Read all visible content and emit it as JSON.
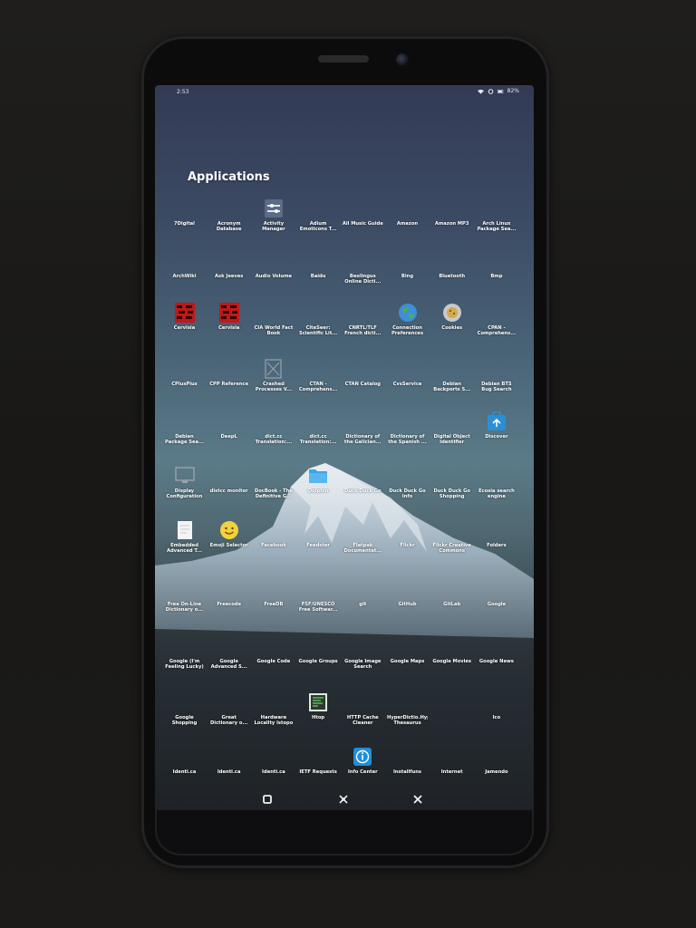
{
  "status": {
    "time": "2:53",
    "battery": "82%"
  },
  "title": "Applications",
  "apps": [
    {
      "label": "7Digital",
      "icon": "none"
    },
    {
      "label": "Acronym Database",
      "icon": "none"
    },
    {
      "label": "Activity Manager",
      "icon": "activity-manager"
    },
    {
      "label": "Adium Emoticons T...",
      "icon": "none"
    },
    {
      "label": "All Music Guide",
      "icon": "none"
    },
    {
      "label": "Amazon",
      "icon": "none"
    },
    {
      "label": "Amazon MP3",
      "icon": "none"
    },
    {
      "label": "Arch Linux Package Sea...",
      "icon": "none"
    },
    {
      "label": "ArchWiki",
      "icon": "none"
    },
    {
      "label": "Ask Jeeves",
      "icon": "none"
    },
    {
      "label": "Audio Volume",
      "icon": "none"
    },
    {
      "label": "Baidu",
      "icon": "none"
    },
    {
      "label": "Beolingus Online Dicti...",
      "icon": "none"
    },
    {
      "label": "Bing",
      "icon": "none"
    },
    {
      "label": "Bluetooth",
      "icon": "none"
    },
    {
      "label": "Bmp",
      "icon": "none"
    },
    {
      "label": "Cervisia",
      "icon": "cervisia"
    },
    {
      "label": "Cervisia",
      "icon": "cervisia"
    },
    {
      "label": "CIA World Fact Book",
      "icon": "none"
    },
    {
      "label": "CiteSeer: Scientific Lit...",
      "icon": "none"
    },
    {
      "label": "CNRTL/TLF French dicti...",
      "icon": "none"
    },
    {
      "label": "Connection Preferences",
      "icon": "globe"
    },
    {
      "label": "Cookies",
      "icon": "cookies"
    },
    {
      "label": "CPAN - Comprehens...",
      "icon": "none"
    },
    {
      "label": "CPlusPlus",
      "icon": "none"
    },
    {
      "label": "CPP Reference",
      "icon": "none"
    },
    {
      "label": "Crashed Processes V...",
      "icon": "crash"
    },
    {
      "label": "CTAN - Comprehens...",
      "icon": "none"
    },
    {
      "label": "CTAN Catalog",
      "icon": "none"
    },
    {
      "label": "CvsService",
      "icon": "none"
    },
    {
      "label": "Debian Backports S...",
      "icon": "none"
    },
    {
      "label": "Debian BTS Bug Search",
      "icon": "none"
    },
    {
      "label": "Debian Package Sea...",
      "icon": "none"
    },
    {
      "label": "DeepL",
      "icon": "none"
    },
    {
      "label": "dict.cc Translation:...",
      "icon": "none"
    },
    {
      "label": "dict.cc Translation:...",
      "icon": "none"
    },
    {
      "label": "Dictionary of the Galician...",
      "icon": "none"
    },
    {
      "label": "Dictionary of the Spanish ...",
      "icon": "none"
    },
    {
      "label": "Digital Object Identifier",
      "icon": "none"
    },
    {
      "label": "Discover",
      "icon": "discover"
    },
    {
      "label": "Display Configuration",
      "icon": "display"
    },
    {
      "label": "distcc monitor",
      "icon": "none"
    },
    {
      "label": "DocBook - The Definitive G...",
      "icon": "none"
    },
    {
      "label": "Dolphin",
      "icon": "folder"
    },
    {
      "label": "Duck Duck Go",
      "icon": "none"
    },
    {
      "label": "Duck Duck Go Info",
      "icon": "none"
    },
    {
      "label": "Duck Duck Go Shopping",
      "icon": "none"
    },
    {
      "label": "Ecosia search engine",
      "icon": "none"
    },
    {
      "label": "Embedded Advanced T...",
      "icon": "document"
    },
    {
      "label": "Emoji Selector",
      "icon": "emoji"
    },
    {
      "label": "Facebook",
      "icon": "none"
    },
    {
      "label": "Feedster",
      "icon": "none"
    },
    {
      "label": "Flatpak Documentat...",
      "icon": "none"
    },
    {
      "label": "Flickr",
      "icon": "none"
    },
    {
      "label": "Flickr Creative Commons",
      "icon": "none"
    },
    {
      "label": "Folders",
      "icon": "none"
    },
    {
      "label": "Free On-Line Dictionary o...",
      "icon": "none"
    },
    {
      "label": "Freecode",
      "icon": "none"
    },
    {
      "label": "FreeDB",
      "icon": "none"
    },
    {
      "label": "FSF/UNESCO Free Softwar...",
      "icon": "none"
    },
    {
      "label": "git",
      "icon": "none"
    },
    {
      "label": "GitHub",
      "icon": "none"
    },
    {
      "label": "GitLab",
      "icon": "none"
    },
    {
      "label": "Google",
      "icon": "none"
    },
    {
      "label": "Google (I'm Feeling Lucky)",
      "icon": "none"
    },
    {
      "label": "Google Advanced S...",
      "icon": "none"
    },
    {
      "label": "Google Code",
      "icon": "none"
    },
    {
      "label": "Google Groups",
      "icon": "none"
    },
    {
      "label": "Google Image Search",
      "icon": "none"
    },
    {
      "label": "Google Maps",
      "icon": "none"
    },
    {
      "label": "Google Movies",
      "icon": "none"
    },
    {
      "label": "Google News",
      "icon": "none"
    },
    {
      "label": "Google Shopping",
      "icon": "none"
    },
    {
      "label": "Great Dictionary o...",
      "icon": "none"
    },
    {
      "label": "Hardware Locality lstopo",
      "icon": "none"
    },
    {
      "label": "Htop",
      "icon": "htop"
    },
    {
      "label": "HTTP Cache Cleaner",
      "icon": "none"
    },
    {
      "label": "HyperDictio.HyperDictionary.com Thesaurus",
      "icon": "none"
    },
    {
      "label": "",
      "icon": "none"
    },
    {
      "label": "Ico",
      "icon": "none"
    },
    {
      "label": "Identi.ca",
      "icon": "none"
    },
    {
      "label": "Identi.ca",
      "icon": "none"
    },
    {
      "label": "Identi.ca",
      "icon": "none"
    },
    {
      "label": "IETF Requests",
      "icon": "none"
    },
    {
      "label": "Info Center",
      "icon": "info"
    },
    {
      "label": "Installfuns",
      "icon": "none"
    },
    {
      "label": "Internet",
      "icon": "none"
    },
    {
      "label": "Jamendo",
      "icon": "none"
    }
  ],
  "navbar": {
    "home": "home-icon",
    "kde": "kde-icon",
    "close": "close-icon"
  }
}
